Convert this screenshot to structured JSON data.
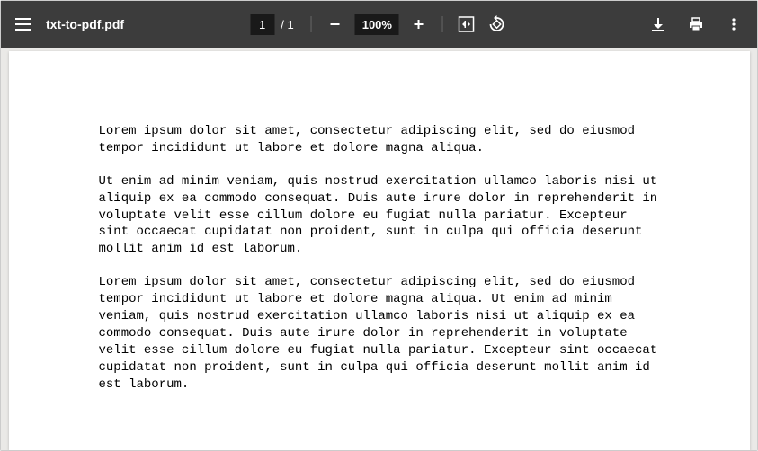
{
  "toolbar": {
    "filename": "txt-to-pdf.pdf",
    "page_current": "1",
    "page_total": "/ 1",
    "zoom_level": "100%"
  },
  "document": {
    "paragraphs": [
      "Lorem ipsum dolor sit amet, consectetur adipiscing elit, sed do eiusmod tempor incididunt ut labore et dolore magna aliqua.",
      "Ut enim ad minim veniam, quis nostrud exercitation ullamco laboris nisi ut aliquip ex ea commodo consequat. Duis aute irure dolor in reprehenderit in voluptate velit esse cillum dolore eu fugiat nulla pariatur. Excepteur sint occaecat cupidatat non proident, sunt in culpa qui officia deserunt mollit anim id est laborum.",
      "Lorem ipsum dolor sit amet, consectetur adipiscing elit, sed do eiusmod tempor incididunt ut labore et dolore magna aliqua. Ut enim ad minim veniam, quis nostrud exercitation ullamco laboris nisi ut aliquip ex ea commodo consequat. Duis aute irure dolor in reprehenderit in voluptate velit esse cillum dolore eu fugiat nulla pariatur. Excepteur sint occaecat cupidatat non proident, sunt in culpa qui officia deserunt mollit anim id est laborum."
    ]
  }
}
